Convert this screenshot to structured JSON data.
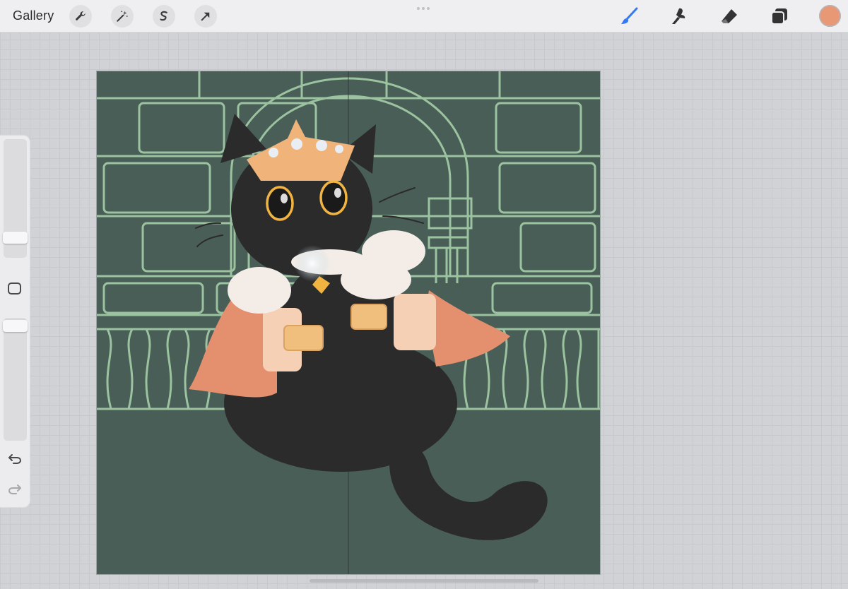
{
  "toolbar": {
    "gallery_label": "Gallery",
    "left_tools": [
      {
        "icon": "wrench-icon",
        "name": "actions"
      },
      {
        "icon": "magic-wand-icon",
        "name": "adjustments"
      },
      {
        "icon": "selection-icon",
        "name": "selection"
      },
      {
        "icon": "transform-arrow-icon",
        "name": "transform"
      }
    ],
    "right_tools": [
      {
        "icon": "brush-icon",
        "name": "paint",
        "active": true,
        "active_color": "#3478f6"
      },
      {
        "icon": "smudge-icon",
        "name": "smudge"
      },
      {
        "icon": "eraser-icon",
        "name": "eraser"
      },
      {
        "icon": "layers-icon",
        "name": "layers"
      }
    ],
    "current_color": "#e89874"
  },
  "sidebar": {
    "brush_size": 0.82,
    "opacity": 1.0,
    "modify_button_icon": "square-icon",
    "undo_icon": "undo-icon",
    "redo_icon": "redo-icon"
  },
  "canvas": {
    "background_color": "#4a5e58",
    "line_color": "#9cc39f",
    "artwork": "black-cat-king-illustration"
  },
  "colors": {
    "cat": "#2b2b2b",
    "crown": "#f0b47a",
    "cape": "#e4906f",
    "fur": "#f4ede7",
    "eye_ring": "#f2b440"
  }
}
